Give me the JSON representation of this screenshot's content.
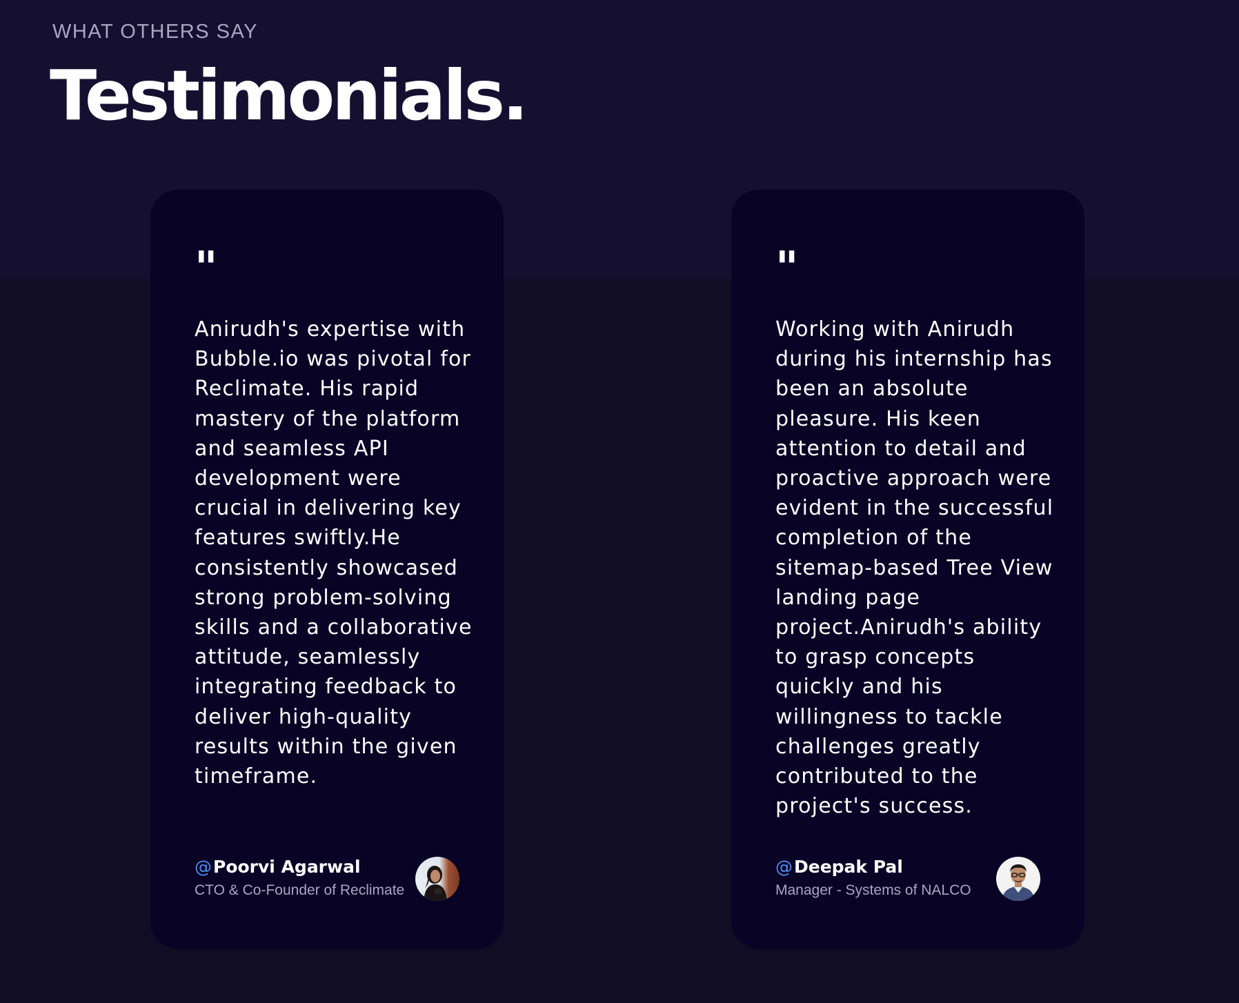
{
  "section": {
    "eyebrow": "WHAT OTHERS SAY",
    "title": "Testimonials."
  },
  "colors": {
    "page_bg": "#100d25",
    "top_band_bg": "#151030",
    "card_bg": "#090325",
    "accent_at": "#4f8ff7",
    "secondary_text": "#aaa6c3"
  },
  "testimonials": [
    {
      "quote_icon": "quote-icon",
      "text": "Anirudh's expertise with Bubble.io was pivotal for Reclimate. His rapid mastery of the platform and seamless API development were crucial in delivering key features swiftly.He consistently showcased strong problem-solving skills and a collaborative attitude, seamlessly integrating feedback to deliver high-quality results within the given timeframe.",
      "at": "@",
      "name": "Poorvi Agarwal",
      "role": "CTO & Co-Founder of Reclimate"
    },
    {
      "quote_icon": "quote-icon",
      "text": "Working with Anirudh during his internship has been an absolute pleasure. His keen attention to detail and proactive approach were evident in the successful completion of the sitemap-based Tree View landing page project.Anirudh's ability to grasp concepts quickly and his willingness to tackle challenges greatly contributed to the project's success.",
      "at": "@",
      "name": "Deepak Pal",
      "role": "Manager - Systems of NALCO"
    }
  ]
}
